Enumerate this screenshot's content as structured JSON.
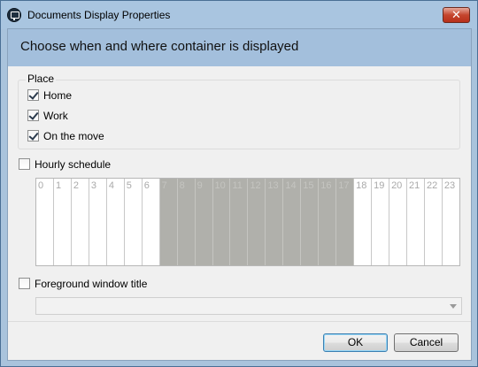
{
  "window": {
    "title": "Documents Display Properties",
    "close_glyph": "✕"
  },
  "header": {
    "text": "Choose when and where container is displayed"
  },
  "place": {
    "label": "Place",
    "items": [
      {
        "label": "Home",
        "checked": true
      },
      {
        "label": "Work",
        "checked": true
      },
      {
        "label": "On the move",
        "checked": true
      }
    ]
  },
  "hourly": {
    "label": "Hourly schedule",
    "checked": false,
    "hours": [
      "0",
      "1",
      "2",
      "3",
      "4",
      "5",
      "6",
      "7",
      "8",
      "9",
      "10",
      "11",
      "12",
      "13",
      "14",
      "15",
      "16",
      "17",
      "18",
      "19",
      "20",
      "21",
      "22",
      "23"
    ],
    "selected_hours": [
      "7",
      "8",
      "9",
      "10",
      "11",
      "12",
      "13",
      "14",
      "15",
      "16",
      "17"
    ]
  },
  "foreground": {
    "label": "Foreground window title",
    "checked": false,
    "value": ""
  },
  "buttons": {
    "ok": "OK",
    "cancel": "Cancel"
  },
  "colors": {
    "header_band": "#a3bfdc",
    "selected_hour": "#b0b0ab",
    "title_bar": "#a9c5e0"
  },
  "icons": {
    "app": "monitor-icon",
    "close": "close-icon",
    "dropdown": "chevron-down-icon"
  }
}
